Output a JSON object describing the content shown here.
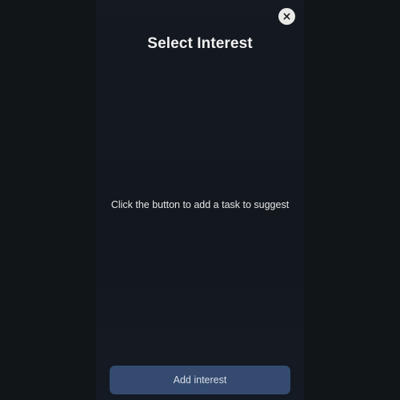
{
  "header": {
    "title": "Select Interest",
    "close_icon": "close-icon"
  },
  "main": {
    "empty_message": "Click the button to add a task to suggest"
  },
  "footer": {
    "add_button_label": "Add interest"
  },
  "colors": {
    "background": "#121518",
    "button": "#344b6f",
    "close_button_bg": "#e8e8e6",
    "text": "#f2f2f2"
  }
}
